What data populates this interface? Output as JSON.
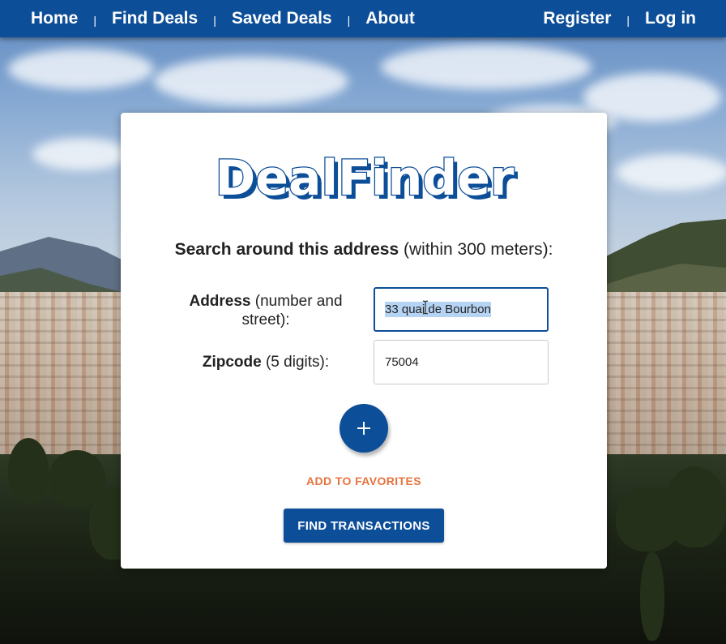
{
  "nav": {
    "home": "Home",
    "find_deals": "Find Deals",
    "saved_deals": "Saved Deals",
    "about": "About",
    "register": "Register",
    "login": "Log in",
    "separator": "|"
  },
  "logo": {
    "text": "DealFinder"
  },
  "search": {
    "headline_bold": "Search around this address",
    "headline_rest": " (within 300 meters):",
    "address_label_bold": "Address",
    "address_label_rest": " (number and street):",
    "address_value": "33 quai de Bourbon",
    "zipcode_label_bold": "Zipcode",
    "zipcode_label_rest": " (5 digits):",
    "zipcode_value": "75004"
  },
  "actions": {
    "add_favorite_icon": "plus-icon",
    "add_favorite_label": "ADD TO FAVORITES",
    "find_label": "FIND TRANSACTIONS"
  },
  "colors": {
    "primary": "#0d4e99",
    "accent": "#e8723d",
    "selection": "#b5d3f3"
  }
}
